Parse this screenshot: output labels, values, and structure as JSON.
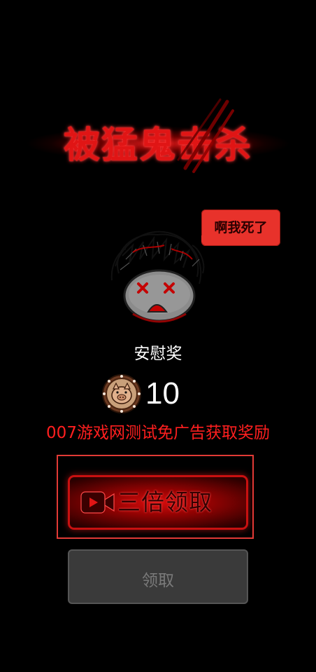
{
  "title": "被猛鬼击杀",
  "speech": "啊我死了",
  "prize_label": "安慰奖",
  "reward": {
    "amount": "10",
    "icon": "coin-icon"
  },
  "watermark": "007游戏网测试免广告获取奖励",
  "buttons": {
    "triple_claim": "三倍领取",
    "claim": "领取"
  },
  "colors": {
    "accent_red": "#e01515",
    "background": "#000000",
    "disabled_gray": "#3a3a3a"
  }
}
